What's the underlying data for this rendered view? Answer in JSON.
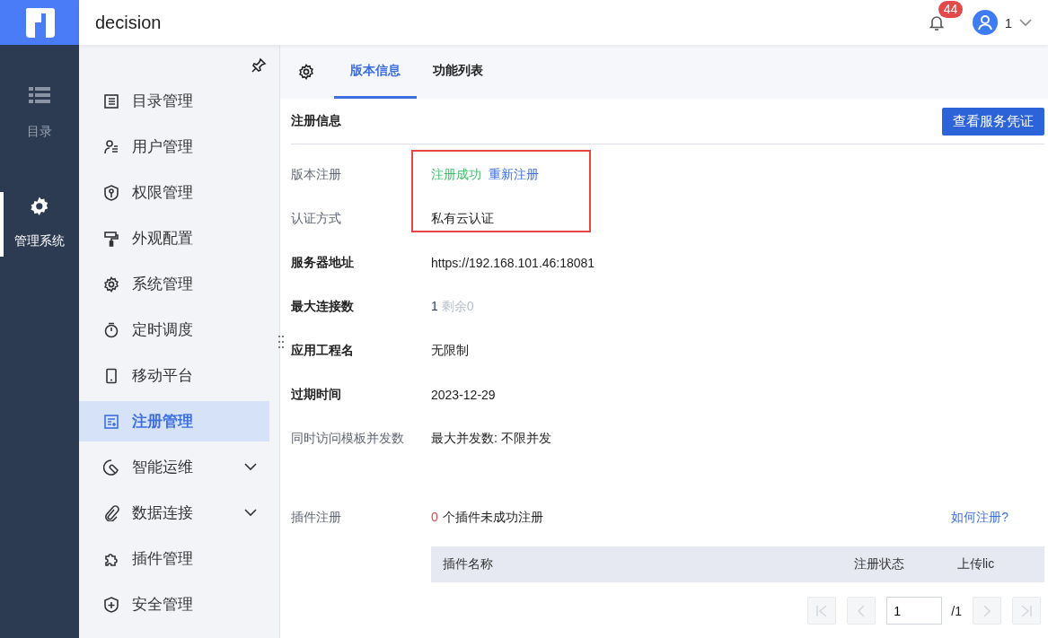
{
  "header": {
    "title": "decision",
    "notifications": {
      "count": "44"
    },
    "user": {
      "name": "1"
    }
  },
  "rail": [
    {
      "label": "目录",
      "selected": false
    },
    {
      "label": "管理系统",
      "selected": true
    }
  ],
  "nav": [
    {
      "label": "目录管理",
      "selected": false,
      "submenu": false
    },
    {
      "label": "用户管理",
      "selected": false,
      "submenu": false
    },
    {
      "label": "权限管理",
      "selected": false,
      "submenu": false
    },
    {
      "label": "外观配置",
      "selected": false,
      "submenu": false
    },
    {
      "label": "系统管理",
      "selected": false,
      "submenu": false
    },
    {
      "label": "定时调度",
      "selected": false,
      "submenu": false
    },
    {
      "label": "移动平台",
      "selected": false,
      "submenu": false
    },
    {
      "label": "注册管理",
      "selected": true,
      "submenu": false
    },
    {
      "label": "智能运维",
      "selected": false,
      "submenu": true
    },
    {
      "label": "数据连接",
      "selected": false,
      "submenu": true
    },
    {
      "label": "插件管理",
      "selected": false,
      "submenu": false
    },
    {
      "label": "安全管理",
      "selected": false,
      "submenu": false
    }
  ],
  "tabs": [
    {
      "label": "版本信息",
      "selected": true
    },
    {
      "label": "功能列表",
      "selected": false
    }
  ],
  "section": {
    "title": "注册信息",
    "button": "查看服务凭证"
  },
  "info_rows": [
    {
      "label": "版本注册",
      "bold": false,
      "highlighted": true,
      "value": [
        {
          "kind": "success",
          "text": "注册成功"
        },
        {
          "kind": "link",
          "text": "重新注册"
        }
      ]
    },
    {
      "label": "认证方式",
      "bold": false,
      "highlighted": true,
      "value": [
        {
          "kind": "text",
          "text": "私有云认证"
        }
      ]
    },
    {
      "label": "服务器地址",
      "bold": true,
      "highlighted": false,
      "value": [
        {
          "kind": "text",
          "text": "https://192.168.101.46:18081"
        }
      ]
    },
    {
      "label": "最大连接数",
      "bold": true,
      "highlighted": false,
      "value": [
        {
          "kind": "count",
          "text": "1"
        },
        {
          "kind": "muted",
          "text": "剩余0"
        }
      ]
    },
    {
      "label": "应用工程名",
      "bold": true,
      "highlighted": false,
      "value": [
        {
          "kind": "text",
          "text": "无限制"
        }
      ]
    },
    {
      "label": "过期时间",
      "bold": true,
      "highlighted": false,
      "value": [
        {
          "kind": "text",
          "text": "2023-12-29"
        }
      ]
    },
    {
      "label": "同时访问模板并发数",
      "bold": false,
      "highlighted": false,
      "value": [
        {
          "kind": "text",
          "text": "最大并发数: 不限并发"
        }
      ]
    }
  ],
  "plugins": {
    "label": "插件注册",
    "failed_count": "0",
    "summary": "个插件未成功注册",
    "help_link": "如何注册?",
    "table": {
      "columns": [
        "插件名称",
        "注册状态",
        "上传lic"
      ]
    },
    "pager": {
      "page": "1",
      "total": "/1",
      "first_disabled": true,
      "prev_disabled": true,
      "next_disabled": true,
      "last_disabled": true
    }
  }
}
